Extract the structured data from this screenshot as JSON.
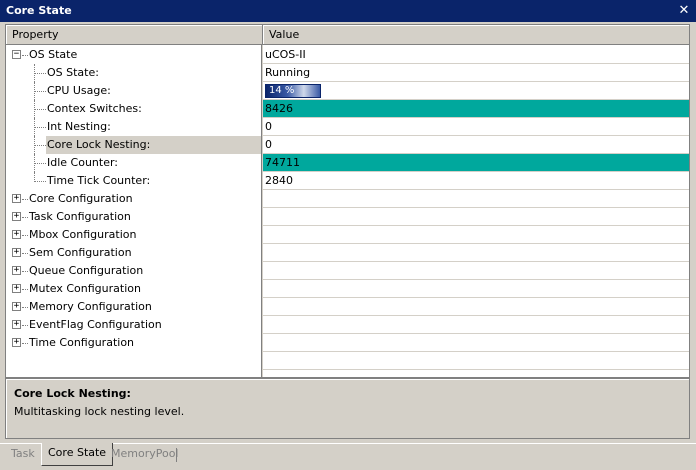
{
  "window": {
    "title": "Core State",
    "close_glyph": "✕"
  },
  "columns": {
    "property": "Property",
    "value": "Value"
  },
  "rows": [
    {
      "label": "OS State",
      "value": "uCOS-II",
      "level": 0,
      "expander": "−"
    },
    {
      "label": "OS State:",
      "value": "Running",
      "level": 1
    },
    {
      "label": "CPU Usage:",
      "value": "14 %",
      "level": 1,
      "progress": 0.14
    },
    {
      "label": "Contex Switches:",
      "value": "8426",
      "level": 1,
      "highlight": "#00a89d"
    },
    {
      "label": "Int Nesting:",
      "value": "0",
      "level": 1
    },
    {
      "label": "Core Lock Nesting:",
      "value": "0",
      "level": 1,
      "selected": true
    },
    {
      "label": "Idle Counter:",
      "value": "74711",
      "level": 1,
      "highlight": "#00a89d"
    },
    {
      "label": "Time Tick Counter:",
      "value": "2840",
      "level": 1
    },
    {
      "label": "Core Configuration",
      "value": "",
      "level": 0,
      "expander": "+"
    },
    {
      "label": "Task Configuration",
      "value": "",
      "level": 0,
      "expander": "+"
    },
    {
      "label": "Mbox Configuration",
      "value": "",
      "level": 0,
      "expander": "+"
    },
    {
      "label": "Sem Configuration",
      "value": "",
      "level": 0,
      "expander": "+"
    },
    {
      "label": "Queue Configuration",
      "value": "",
      "level": 0,
      "expander": "+"
    },
    {
      "label": "Mutex Configuration",
      "value": "",
      "level": 0,
      "expander": "+"
    },
    {
      "label": "Memory Configuration",
      "value": "",
      "level": 0,
      "expander": "+"
    },
    {
      "label": "EventFlag Configuration",
      "value": "",
      "level": 0,
      "expander": "+"
    },
    {
      "label": "Time Configuration",
      "value": "",
      "level": 0,
      "expander": "+"
    },
    {
      "label": "",
      "value": "",
      "level": -1
    }
  ],
  "description": {
    "title": "Core Lock Nesting:",
    "text": "Multitasking lock nesting level."
  },
  "tabs": [
    {
      "label": "Task",
      "active": false
    },
    {
      "label": "Core State",
      "active": true
    },
    {
      "label": "MemoryPool",
      "active": false
    }
  ]
}
